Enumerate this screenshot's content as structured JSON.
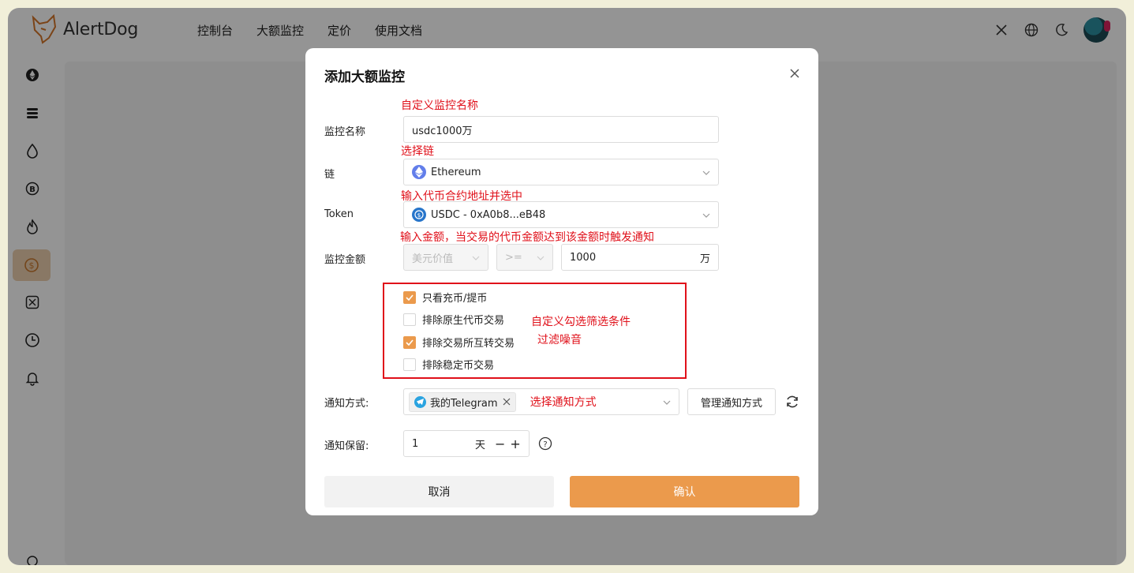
{
  "brand": {
    "name": "AlertDog"
  },
  "nav": {
    "items": [
      "控制台",
      "大额监控",
      "定价",
      "使用文档"
    ]
  },
  "topbar": {
    "icons": [
      "x-logo-icon",
      "globe-icon",
      "moon-icon"
    ]
  },
  "sidebar": {
    "icons": [
      "ethereum-icon",
      "stack-icon",
      "drop-icon",
      "bitcoin-icon",
      "flame-icon",
      "dollar-icon",
      "x-logo-icon",
      "clock-icon",
      "bell-icon",
      "gear-icon"
    ],
    "active_index": 5
  },
  "modal": {
    "title": "添加大额监控",
    "annotations": {
      "name": "自定义监控名称",
      "chain": "选择链",
      "token": "输入代币合约地址并选中",
      "amount": "输入金额，当交易的代币金额达到该金额时触发通知",
      "filter_line1": "自定义勾选筛选条件",
      "filter_line2": "过滤噪音",
      "notify": "选择通知方式"
    },
    "fields": {
      "name_label": "监控名称",
      "name_value": "usdc1000万",
      "chain_label": "链",
      "chain_value": "Ethereum",
      "token_label": "Token",
      "token_value": "USDC - 0xA0b8...eB48",
      "amount_label": "监控金额",
      "amount_type": "美元价值",
      "amount_op": ">=",
      "amount_value": "1000",
      "amount_unit": "万",
      "notify_label": "通知方式:",
      "notify_tag": "我的Telegram",
      "manage_label": "管理通知方式",
      "retention_label": "通知保留:",
      "retention_value": "1",
      "retention_unit": "天"
    },
    "checkboxes": [
      {
        "label": "只看充币/提币",
        "checked": true
      },
      {
        "label": "排除原生代币交易",
        "checked": false
      },
      {
        "label": "排除交易所互转交易",
        "checked": true
      },
      {
        "label": "排除稳定币交易",
        "checked": false
      }
    ],
    "buttons": {
      "cancel": "取消",
      "confirm": "确认"
    }
  },
  "colors": {
    "accent": "#eb9a4c",
    "annotation": "#e0101a"
  }
}
